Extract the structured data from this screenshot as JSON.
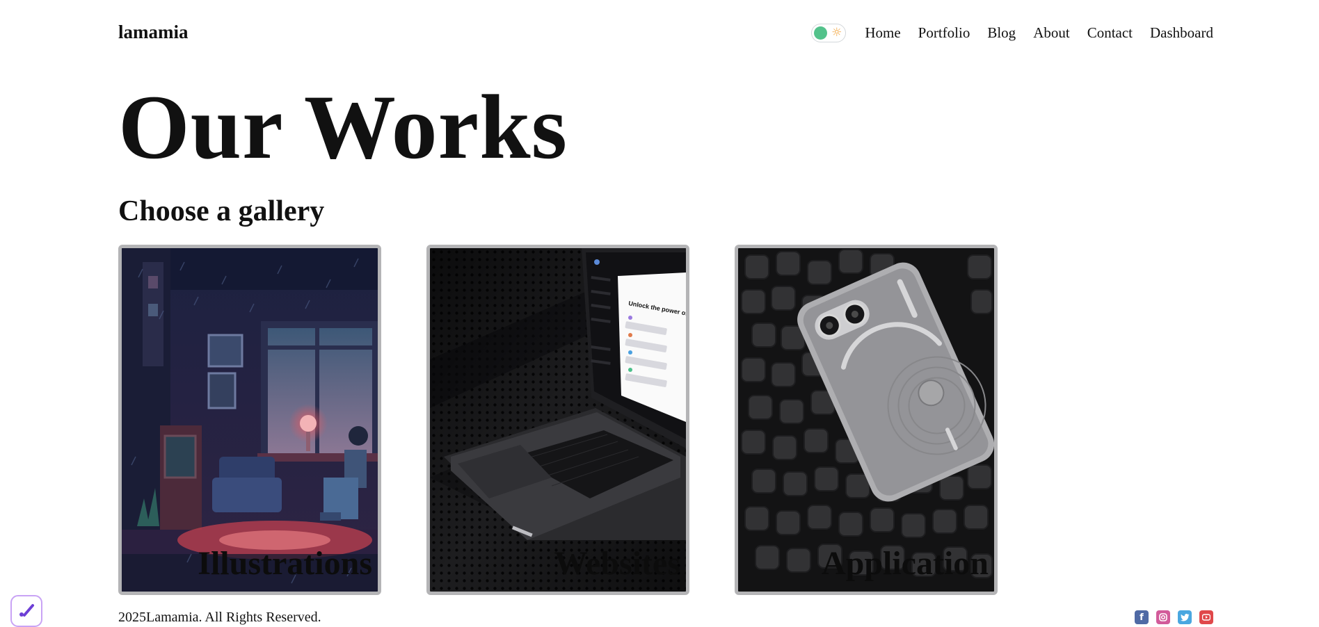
{
  "header": {
    "logo": "lamamia",
    "theme_toggle_icon": "sun-icon",
    "nav": [
      {
        "label": "Home"
      },
      {
        "label": "Portfolio"
      },
      {
        "label": "Blog"
      },
      {
        "label": "About"
      },
      {
        "label": "Contact"
      },
      {
        "label": "Dashboard"
      }
    ]
  },
  "main": {
    "title": "Our Works",
    "subtitle": "Choose a gallery",
    "galleries": [
      {
        "label": "Illustrations",
        "image": "pixel-art-room-illustration"
      },
      {
        "label": "Websites",
        "image": "laptop-mockup"
      },
      {
        "label": "Application",
        "image": "phone-on-foam"
      }
    ]
  },
  "footer": {
    "copyright": "2025Lamamia. All Rights Reserved.",
    "social_icons": [
      "facebook-icon",
      "instagram-icon",
      "twitter-icon",
      "youtube-icon"
    ]
  },
  "colors": {
    "toggle_knob": "#53c28b",
    "sun": "#f2a33a",
    "card_border": "#b4b4b6",
    "facebook": "#4f6aa5",
    "instagram": "#d25b9a",
    "twitter": "#4aa7e0",
    "youtube": "#e0484a",
    "fab_accent": "#6d3fd6"
  }
}
